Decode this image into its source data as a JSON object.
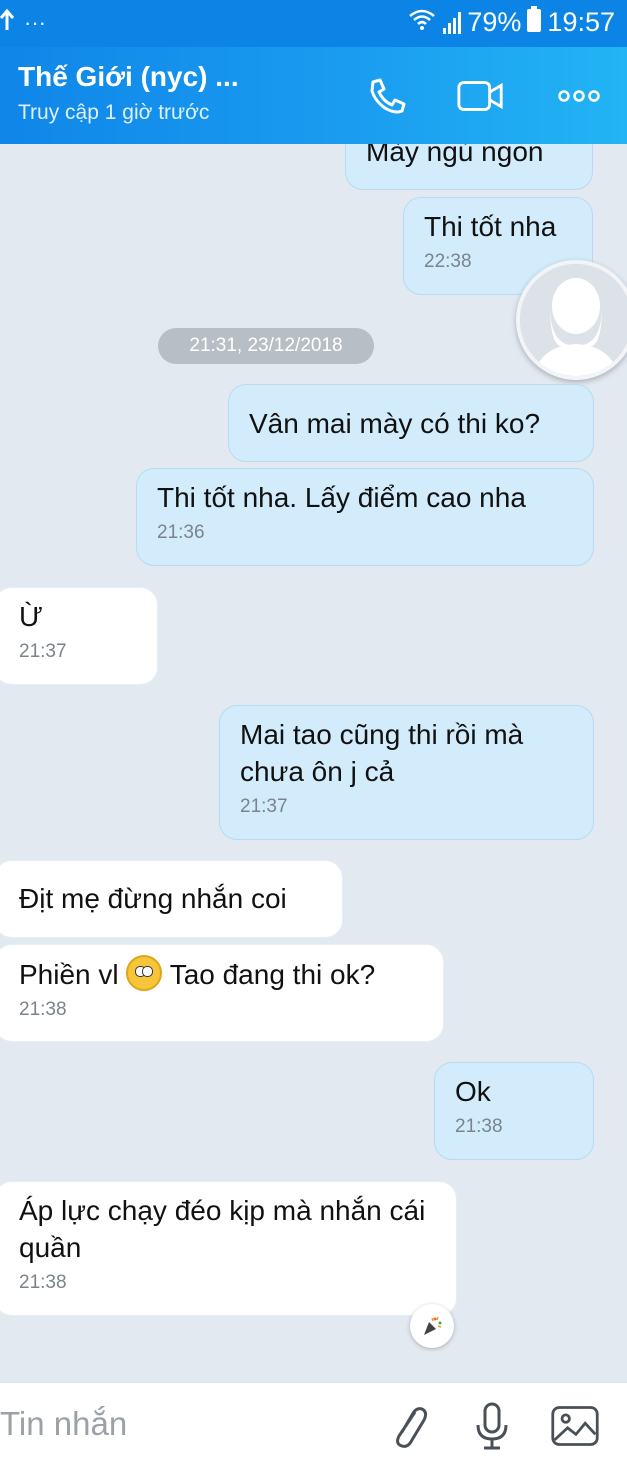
{
  "status_bar": {
    "left_icons": [
      "upload-arrow-icon",
      "more-dots-icon"
    ],
    "left_dots": "···",
    "battery": "79%",
    "time": "19:57"
  },
  "header": {
    "title": "Thế Giới (nyc) ...",
    "subtitle": "Truy cập 1 giờ trước",
    "icons": [
      "phone-icon",
      "video-call-icon",
      "more-options-icon"
    ]
  },
  "messages": [
    {
      "dir": "out",
      "text": "Mày ngủ ngon",
      "time": ""
    },
    {
      "dir": "out",
      "text": "Thi tốt nha",
      "time": "22:38"
    },
    {
      "dir": "out",
      "text": "Vân mai mày có thi ko?",
      "time": ""
    },
    {
      "dir": "out",
      "text": "Thi tốt nha. Lấy điểm cao nha",
      "time": "21:36"
    },
    {
      "dir": "in",
      "text": "Ừ",
      "time": "21:37"
    },
    {
      "dir": "out",
      "text": "Mai tao cũng thi rồi mà chưa ôn j cả",
      "time": "21:37"
    },
    {
      "dir": "in",
      "text": "Địt mẹ đừng nhắn coi",
      "time": ""
    },
    {
      "dir": "in",
      "text_before": "Phiền vl",
      "text_after": "Tao đang thi ok?",
      "time": "21:38"
    },
    {
      "dir": "out",
      "text": "Ok",
      "time": "21:38"
    },
    {
      "dir": "in",
      "text": "Áp lực chạy đéo kịp mà nhắn cái quần",
      "time": "21:38"
    }
  ],
  "date_separator": "21:31, 23/12/2018",
  "input": {
    "placeholder": "Tin nhắn",
    "icons": [
      "attach-icon",
      "microphone-icon",
      "image-icon"
    ]
  },
  "colors": {
    "header": "#1a9cf0",
    "outgoing_bubble": "#d2ecfb",
    "incoming_bubble": "#ffffff",
    "background": "#e2e9f1"
  }
}
